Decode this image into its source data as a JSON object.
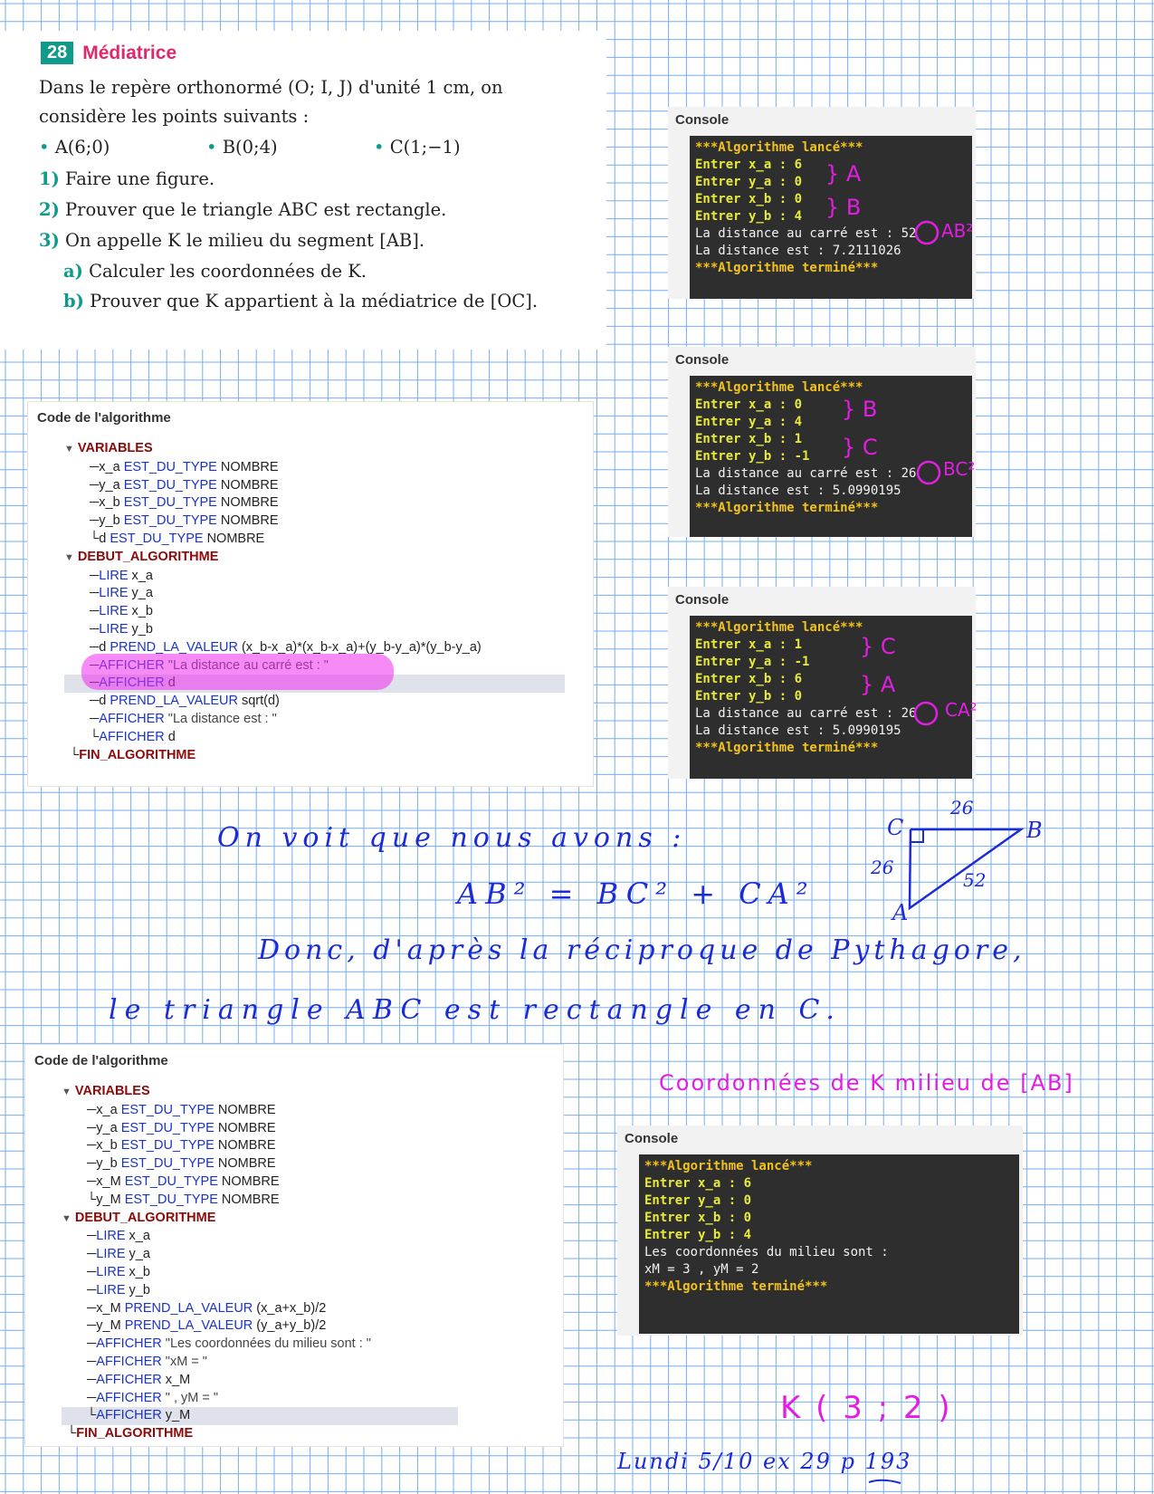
{
  "exercise": {
    "number": "28",
    "title": "Médiatrice",
    "intro1": "Dans le repère orthonormé (O; I, J) d'unité 1 cm, on",
    "intro2": "considère les points suivants :",
    "points": [
      "A(6;0)",
      "B(0;4)",
      "C(1;−1)"
    ],
    "q1_num": "1)",
    "q1": "Faire une figure.",
    "q2_num": "2)",
    "q2": "Prouver que le triangle ABC est rectangle.",
    "q3_num": "3)",
    "q3": "On appelle K le milieu du segment [AB].",
    "qa_num": "a)",
    "qa": "Calculer les coordonnées de K.",
    "qb_num": "b)",
    "qb": "Prouver que K appartient à la médiatrice de [OC]."
  },
  "consoles": [
    {
      "title": "Console",
      "lines": [
        "***Algorithme lancé***",
        "Entrer x_a : 6",
        "Entrer y_a : 0",
        "Entrer x_b : 0",
        "Entrer y_b : 4",
        "La distance au carré est : 52",
        "La distance est : 7.2111026",
        "***Algorithme terminé***"
      ]
    },
    {
      "title": "Console",
      "lines": [
        "***Algorithme lancé***",
        "Entrer x_a : 0",
        "Entrer y_a : 4",
        "Entrer x_b : 1",
        "Entrer y_b : -1",
        "La distance au carré est : 26",
        "La distance est : 5.0990195",
        "***Algorithme terminé***"
      ]
    },
    {
      "title": "Console",
      "lines": [
        "***Algorithme lancé***",
        "Entrer x_a : 1",
        "Entrer y_a : -1",
        "Entrer x_b : 6",
        "Entrer y_b : 0",
        "La distance au carré est : 26",
        "La distance est : 5.0990195",
        "***Algorithme terminé***"
      ]
    },
    {
      "title": "Console",
      "lines": [
        "***Algorithme lancé***",
        "Entrer x_a : 6",
        "Entrer y_a : 0",
        "Entrer x_b : 0",
        "Entrer y_b : 4",
        "Les coordonnées du milieu sont :",
        "xM = 3 , yM = 2",
        "***Algorithme terminé***"
      ]
    }
  ],
  "code1": {
    "title": "Code de l'algorithme",
    "variables_label": "VARIABLES",
    "variables": [
      {
        "name": "x_a",
        "kw": "EST_DU_TYPE",
        "type": "NOMBRE"
      },
      {
        "name": "y_a",
        "kw": "EST_DU_TYPE",
        "type": "NOMBRE"
      },
      {
        "name": "x_b",
        "kw": "EST_DU_TYPE",
        "type": "NOMBRE"
      },
      {
        "name": "y_b",
        "kw": "EST_DU_TYPE",
        "type": "NOMBRE"
      },
      {
        "name": "d",
        "kw": "EST_DU_TYPE",
        "type": "NOMBRE"
      }
    ],
    "debut_label": "DEBUT_ALGORITHME",
    "steps": [
      {
        "pre": "",
        "kw": "LIRE",
        "arg": " x_a"
      },
      {
        "pre": "",
        "kw": "LIRE",
        "arg": " y_a"
      },
      {
        "pre": "",
        "kw": "LIRE",
        "arg": " x_b"
      },
      {
        "pre": "",
        "kw": "LIRE",
        "arg": " y_b"
      },
      {
        "pre": "d ",
        "kw": "PREND_LA_VALEUR",
        "arg": " (x_b-x_a)*(x_b-x_a)+(y_b-y_a)*(y_b-y_a)"
      },
      {
        "pre": "",
        "kw": "AFFICHER",
        "arg": " \"La distance au carré est : \""
      },
      {
        "pre": "",
        "kw": "AFFICHER",
        "arg": " d"
      },
      {
        "pre": "d ",
        "kw": "PREND_LA_VALEUR",
        "arg": " sqrt(d)"
      },
      {
        "pre": "",
        "kw": "AFFICHER",
        "arg": " \"La distance est : \""
      },
      {
        "pre": "",
        "kw": "AFFICHER",
        "arg": " d"
      }
    ],
    "fin_label": "FIN_ALGORITHME"
  },
  "code2": {
    "title": "Code de l'algorithme",
    "variables_label": "VARIABLES",
    "variables": [
      {
        "name": "x_a",
        "kw": "EST_DU_TYPE",
        "type": "NOMBRE"
      },
      {
        "name": "y_a",
        "kw": "EST_DU_TYPE",
        "type": "NOMBRE"
      },
      {
        "name": "x_b",
        "kw": "EST_DU_TYPE",
        "type": "NOMBRE"
      },
      {
        "name": "y_b",
        "kw": "EST_DU_TYPE",
        "type": "NOMBRE"
      },
      {
        "name": "x_M",
        "kw": "EST_DU_TYPE",
        "type": "NOMBRE"
      },
      {
        "name": "y_M",
        "kw": "EST_DU_TYPE",
        "type": "NOMBRE"
      }
    ],
    "debut_label": "DEBUT_ALGORITHME",
    "steps": [
      {
        "pre": "",
        "kw": "LIRE",
        "arg": " x_a"
      },
      {
        "pre": "",
        "kw": "LIRE",
        "arg": " y_a"
      },
      {
        "pre": "",
        "kw": "LIRE",
        "arg": " x_b"
      },
      {
        "pre": "",
        "kw": "LIRE",
        "arg": " y_b"
      },
      {
        "pre": "x_M ",
        "kw": "PREND_LA_VALEUR",
        "arg": " (x_a+x_b)/2"
      },
      {
        "pre": "y_M ",
        "kw": "PREND_LA_VALEUR",
        "arg": " (y_a+y_b)/2"
      },
      {
        "pre": "",
        "kw": "AFFICHER",
        "arg": " \"Les coordonnées du milieu sont : \""
      },
      {
        "pre": "",
        "kw": "AFFICHER",
        "arg": " \"xM = \""
      },
      {
        "pre": "",
        "kw": "AFFICHER",
        "arg": " x_M"
      },
      {
        "pre": "",
        "kw": "AFFICHER",
        "arg": " \" , yM = \""
      },
      {
        "pre": "",
        "kw": "AFFICHER",
        "arg": " y_M"
      }
    ],
    "fin_label": "FIN_ALGORITHME"
  },
  "handwriting": {
    "ann_a": "} A",
    "ann_b1": "} B",
    "ann_ab2": "AB²",
    "ann_b2": "} B",
    "ann_c2": "} C",
    "ann_bc2": "BC²",
    "ann_c3": "} C",
    "ann_a3": "} A",
    "ann_ca2": "CA²",
    "line1": "On voit que nous avons :",
    "line2": "AB² = BC² + CA²",
    "line3": "Donc, d'après la réciproque de Pythagore,",
    "line4": "le triangle ABC est rectangle en C.",
    "tri_c": "C",
    "tri_b": "B",
    "tri_a": "A",
    "tri_cb": "26",
    "tri_ca": "26",
    "tri_ab": "52",
    "coord_title": "Coordonnées de K milieu de [AB]",
    "result": "K ( 3 ; 2 )",
    "date": "Lundi 5/10 ex 29 p 193"
  },
  "colors": {
    "ink_blue": "#1b2bd6",
    "ink_magenta": "#e21ee2",
    "grid": "#3c8cf0",
    "console_bg": "#2e2e2e",
    "console_yellow": "#f1c21b",
    "teal": "#0f9a8a",
    "title_pink": "#e0286c"
  }
}
